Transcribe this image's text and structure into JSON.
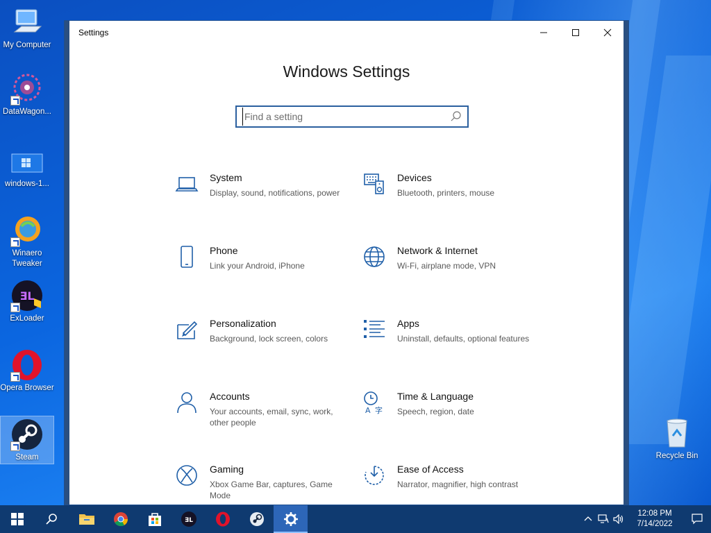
{
  "desktop": {
    "icons": [
      {
        "label": "My Computer"
      },
      {
        "label": "DataWagon..."
      },
      {
        "label": "windows-1..."
      },
      {
        "label": "Winaero Tweaker"
      },
      {
        "label": "ExLoader"
      },
      {
        "label": "Opera Browser"
      },
      {
        "label": "Steam"
      },
      {
        "label": "Recycle Bin"
      }
    ]
  },
  "window": {
    "title": "Settings",
    "heading": "Windows Settings",
    "search_placeholder": "Find a setting",
    "accent": "#1f5fa8"
  },
  "tiles": [
    {
      "name": "System",
      "desc": "Display, sound, notifications, power",
      "icon": "laptop-icon"
    },
    {
      "name": "Devices",
      "desc": "Bluetooth, printers, mouse",
      "icon": "keyboard-speaker-icon"
    },
    {
      "name": "Phone",
      "desc": "Link your Android, iPhone",
      "icon": "phone-icon"
    },
    {
      "name": "Network & Internet",
      "desc": "Wi-Fi, airplane mode, VPN",
      "icon": "globe-icon"
    },
    {
      "name": "Personalization",
      "desc": "Background, lock screen, colors",
      "icon": "paint-icon"
    },
    {
      "name": "Apps",
      "desc": "Uninstall, defaults, optional features",
      "icon": "apps-list-icon"
    },
    {
      "name": "Accounts",
      "desc": "Your accounts, email, sync, work, other people",
      "icon": "person-icon"
    },
    {
      "name": "Time & Language",
      "desc": "Speech, region, date",
      "icon": "time-language-icon"
    },
    {
      "name": "Gaming",
      "desc": "Xbox Game Bar, captures, Game Mode",
      "icon": "xbox-icon"
    },
    {
      "name": "Ease of Access",
      "desc": "Narrator, magnifier, high contrast",
      "icon": "ease-of-access-icon"
    }
  ],
  "taskbar": {
    "clock_time": "12:08 PM",
    "clock_date": "7/14/2022"
  }
}
